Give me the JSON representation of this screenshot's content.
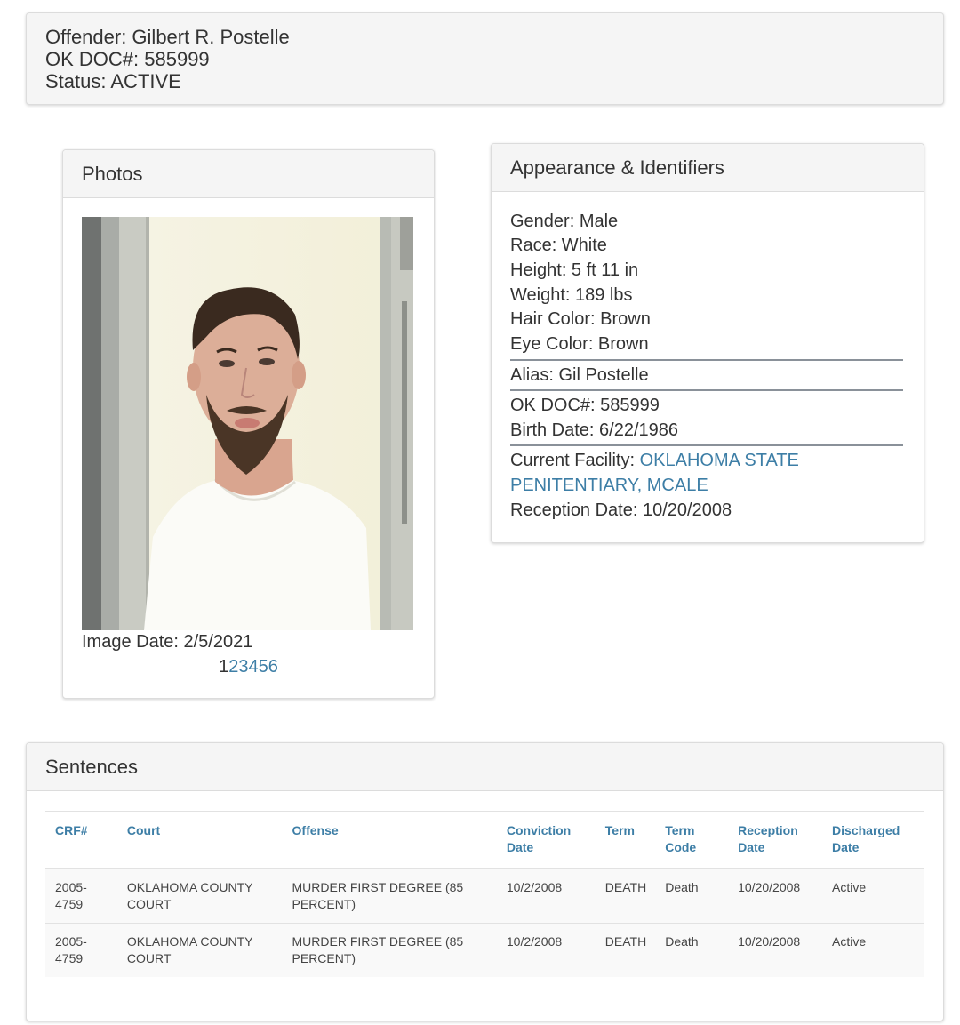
{
  "offender": {
    "name_line": "Offender: Gilbert R. Postelle",
    "doc_line": "OK DOC#: 585999",
    "status_line": "Status: ACTIVE"
  },
  "photos": {
    "title": "Photos",
    "image_date": "Image Date: 2/5/2021",
    "pages": [
      "1",
      "2",
      "3",
      "4",
      "5",
      "6"
    ],
    "current_page": "1"
  },
  "appearance": {
    "title": "Appearance & Identifiers",
    "gender": "Gender: Male",
    "race": "Race: White",
    "height": "Height: 5 ft 11 in",
    "weight": "Weight: 189 lbs",
    "hair": "Hair Color: Brown",
    "eye": "Eye Color: Brown",
    "alias": "Alias: Gil Postelle",
    "doc": "OK DOC#: 585999",
    "birth": "Birth Date: 6/22/1986",
    "facility_label": "Current Facility: ",
    "facility_link_1": "OKLAHOMA STATE",
    "facility_link_2": "PENITENTIARY, MCALE",
    "reception": "Reception Date: 10/20/2008"
  },
  "sentences": {
    "title": "Sentences",
    "headers": [
      "CRF#",
      "Court",
      "Offense",
      "Conviction Date",
      "Term",
      "Term Code",
      "Reception Date",
      "Discharged Date"
    ],
    "rows": [
      [
        "2005-4759",
        "OKLAHOMA COUNTY COURT",
        "MURDER FIRST DEGREE (85 PERCENT)",
        "10/2/2008",
        "DEATH",
        "Death",
        "10/20/2008",
        "Active"
      ],
      [
        "2005-4759",
        "OKLAHOMA COUNTY COURT",
        "MURDER FIRST DEGREE (85 PERCENT)",
        "10/2/2008",
        "DEATH",
        "Death",
        "10/20/2008",
        "Active"
      ]
    ]
  },
  "colors": {
    "link": "#3d7ea6",
    "panel_heading_bg": "#f5f5f5",
    "divider": "#8a9199"
  }
}
